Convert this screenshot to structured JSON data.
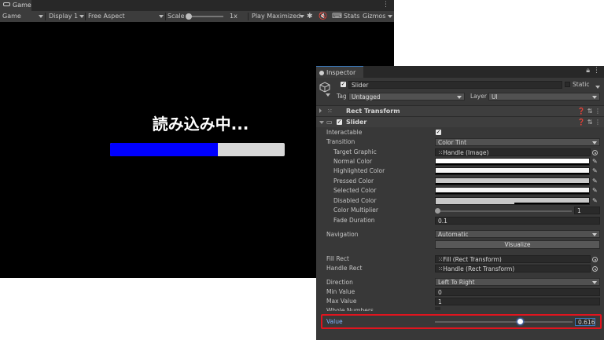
{
  "game": {
    "tab_label": "Game",
    "toolbar": {
      "mode": "Game",
      "display": "Display 1",
      "aspect": "Free Aspect",
      "scale_label": "Scale",
      "scale_value": "1x",
      "play_mode": "Play Maximized",
      "stats": "Stats",
      "gizmos": "Gizmos"
    },
    "loading_text": "読み込み中...",
    "progress": 0.616,
    "colors": {
      "progress_fill": "#0000ff",
      "progress_bg": "#d7d7d7",
      "background": "#000000"
    }
  },
  "inspector": {
    "tab_label": "Inspector",
    "object_name": "Slider",
    "static_label": "Static",
    "tag_label": "Tag",
    "tag_value": "Untagged",
    "layer_label": "Layer",
    "layer_value": "UI",
    "components": {
      "rect_transform": "Rect Transform",
      "slider": "Slider"
    },
    "slider_fields": {
      "interactable": "Interactable",
      "transition": "Transition",
      "transition_value": "Color Tint",
      "target_graphic": "Target Graphic",
      "target_graphic_value": "Handle (Image)",
      "normal_color": "Normal Color",
      "highlighted_color": "Highlighted Color",
      "pressed_color": "Pressed Color",
      "selected_color": "Selected Color",
      "disabled_color": "Disabled Color",
      "color_multiplier": "Color Multiplier",
      "color_multiplier_value": "1",
      "fade_duration": "Fade Duration",
      "fade_duration_value": "0.1",
      "navigation": "Navigation",
      "navigation_value": "Automatic",
      "visualize": "Visualize",
      "fill_rect": "Fill Rect",
      "fill_rect_value": "Fill (Rect Transform)",
      "handle_rect": "Handle Rect",
      "handle_rect_value": "Handle (Rect Transform)",
      "direction": "Direction",
      "direction_value": "Left To Right",
      "min_value": "Min Value",
      "min_value_value": "0",
      "max_value": "Max Value",
      "max_value_value": "1",
      "whole_numbers": "Whole Numbers",
      "value": "Value",
      "value_value": "0.616"
    },
    "colors": {
      "highlight_border": "#e0141e",
      "panel": "#383838"
    }
  }
}
